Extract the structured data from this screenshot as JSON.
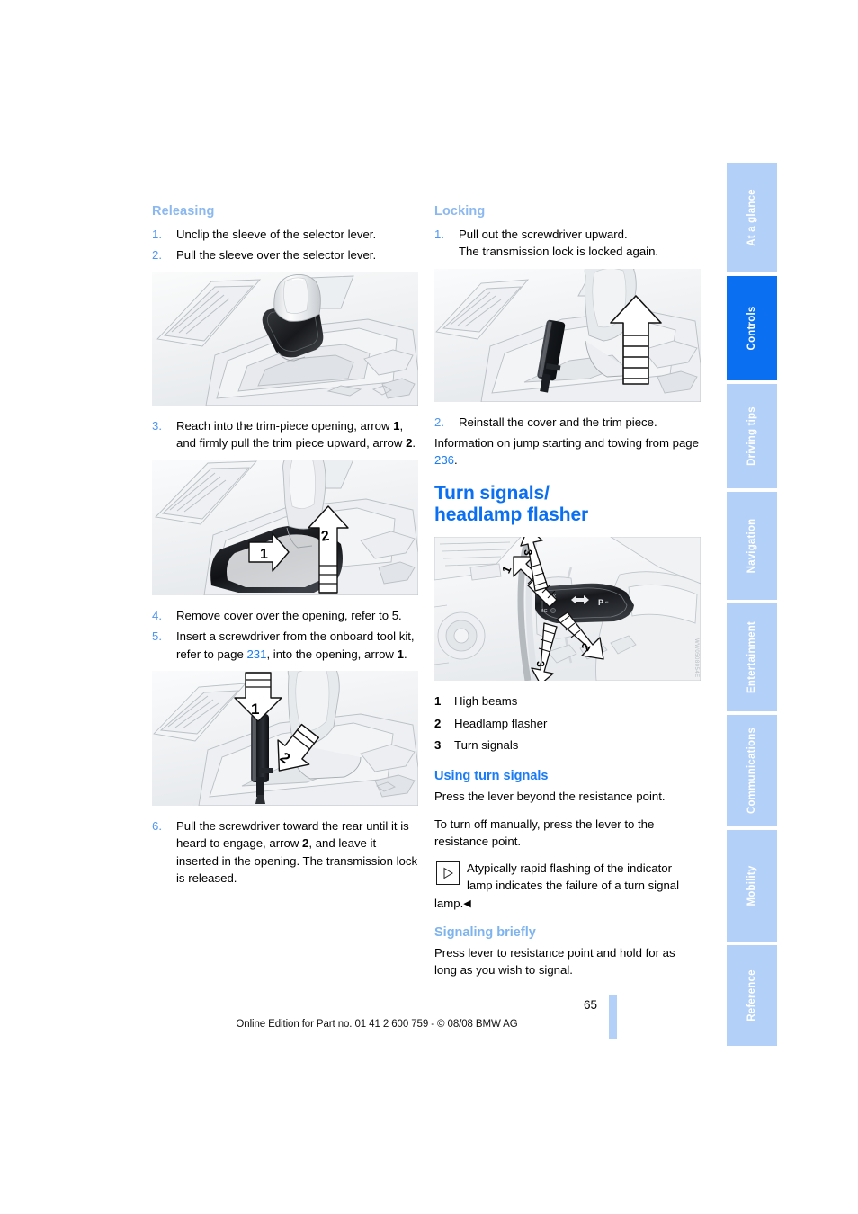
{
  "page": {
    "number": "65",
    "footer": "Online Edition for Part no. 01 41 2 600 759 - © 08/08 BMW AG"
  },
  "colors": {
    "heading_pale_blue": "#8bb8ef",
    "heading_blue": "#1a7cf5",
    "title_blue": "#0b6ff2",
    "tab_inactive": "#b2d0f8",
    "tab_active": "#0b6ff2",
    "link_blue": "#1a7cf5"
  },
  "left_column": {
    "releasing": {
      "heading": "Releasing",
      "steps": [
        {
          "num": "1.",
          "text": "Unclip the sleeve of the selector lever."
        },
        {
          "num": "2.",
          "text": "Pull the sleeve over the selector lever."
        }
      ]
    },
    "figure1": {
      "alt": "Center console with selector lever sleeve unclipped"
    },
    "step3": {
      "num": "3.",
      "part1": "Reach into the trim-piece opening, arrow ",
      "bold1": "1",
      "part2": ", and firmly pull the trim piece upward, arrow ",
      "bold2": "2",
      "part3": "."
    },
    "figure2": {
      "alt": "Center console trim piece with arrows 1 and 2",
      "arrow1": "1",
      "arrow2": "2"
    },
    "step4": {
      "num": "4.",
      "text": "Remove cover over the opening, refer to 5."
    },
    "step5": {
      "num": "5.",
      "part1": "Insert a screwdriver from the onboard tool kit, refer to page ",
      "link": "231",
      "part2": ", into the opening, arrow ",
      "bold1": "1",
      "part3": "."
    },
    "figure3": {
      "alt": "Screwdriver inserted into opening with arrows 1 and 2",
      "arrow1": "1",
      "arrow2": "2"
    },
    "step6": {
      "num": "6.",
      "part1": "Pull the screwdriver toward the rear until it is heard to engage, arrow ",
      "bold1": "2",
      "part2": ", and leave it inserted in the opening. The transmission lock is released."
    }
  },
  "right_column": {
    "locking": {
      "heading": "Locking",
      "step1": {
        "num": "1.",
        "line1": "Pull out the screwdriver upward.",
        "line2": "The transmission lock is locked again."
      }
    },
    "figure4": {
      "alt": "Pulling screwdriver upward out of the console opening"
    },
    "step2": {
      "num": "2.",
      "text": "Reinstall the cover and the trim piece."
    },
    "info": {
      "part1": "Information on jump starting and towing from page ",
      "link": "236",
      "part2": "."
    },
    "turn_signals": {
      "title_line1": "Turn signals/",
      "title_line2": "headlamp flasher"
    },
    "figure5": {
      "alt": "Steering column turn signal lever with arrows 1, 2 and 3",
      "arrow1": "1",
      "arrow2": "2",
      "arrow3a": "3",
      "arrow3b": "3",
      "code": "WW0508054E"
    },
    "legend": [
      {
        "num": "1",
        "text": "High beams"
      },
      {
        "num": "2",
        "text": "Headlamp flasher"
      },
      {
        "num": "3",
        "text": "Turn signals"
      }
    ],
    "using": {
      "heading": "Using turn signals",
      "para1": "Press the lever beyond the resistance point.",
      "para2": "To turn off manually, press the lever to the resistance point.",
      "note": "Atypically rapid flashing of the indicator lamp indicates the failure of a turn signal lamp.",
      "note_end": "◀"
    },
    "signaling": {
      "heading": "Signaling briefly",
      "para": "Press lever to resistance point and hold for as long as you wish to signal."
    }
  },
  "sidebar": {
    "tabs": [
      {
        "label": "At a glance",
        "active": false
      },
      {
        "label": "Controls",
        "active": true
      },
      {
        "label": "Driving tips",
        "active": false
      },
      {
        "label": "Navigation",
        "active": false
      },
      {
        "label": "Entertainment",
        "active": false
      },
      {
        "label": "Communications",
        "active": false
      },
      {
        "label": "Mobility",
        "active": false
      },
      {
        "label": "Reference",
        "active": false
      }
    ]
  }
}
